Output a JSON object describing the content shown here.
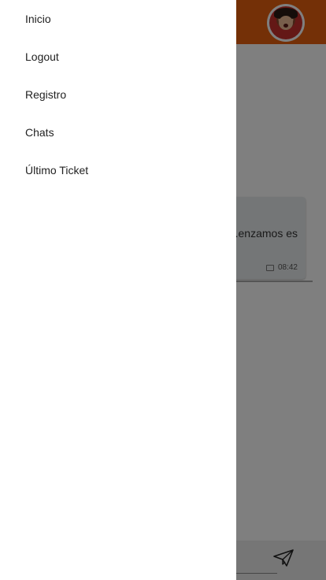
{
  "drawer": {
    "items": [
      {
        "label": "Inicio"
      },
      {
        "label": "Logout"
      },
      {
        "label": "Registro"
      },
      {
        "label": "Chats"
      },
      {
        "label": "Último Ticket"
      }
    ]
  },
  "chat": {
    "message_text": "...enzamos es",
    "message_time": "08:42"
  },
  "colors": {
    "topbar": "#e8600e",
    "scrim": "rgba(0,0,0,0.5)"
  },
  "icons": {
    "avatar": "user-avatar",
    "send": "paper-plane-icon",
    "status": "check-icon"
  }
}
